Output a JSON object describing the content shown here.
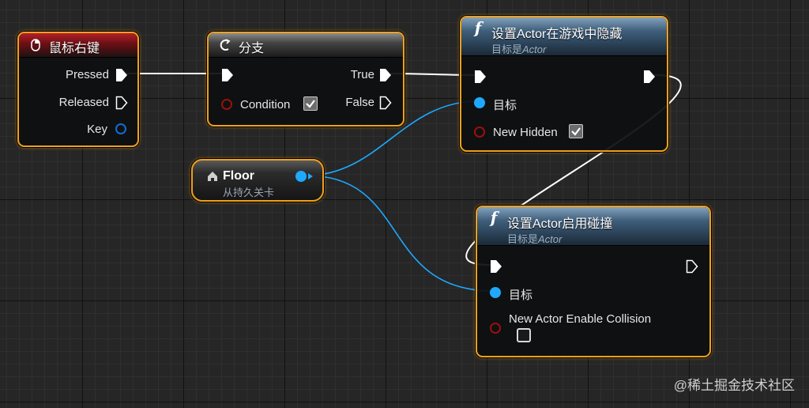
{
  "nodes": {
    "mouse_right": {
      "title": "鼠标右键",
      "pins": {
        "pressed": "Pressed",
        "released": "Released",
        "key": "Key"
      }
    },
    "branch": {
      "title": "分支",
      "pins": {
        "condition": "Condition",
        "true": "True",
        "false": "False"
      },
      "condition_checked": true
    },
    "set_hidden": {
      "title": "设置Actor在游戏中隐藏",
      "subtitle_prefix": "目标是",
      "subtitle_target": "Actor",
      "pins": {
        "target": "目标",
        "new_hidden": "New Hidden"
      },
      "new_hidden_checked": true
    },
    "floor": {
      "title": "Floor",
      "subtitle": "从持久关卡"
    },
    "set_collision": {
      "title": "设置Actor启用碰撞",
      "subtitle_prefix": "目标是",
      "subtitle_target": "Actor",
      "pins": {
        "target": "目标",
        "new_enable_collision": "New Actor Enable Collision"
      },
      "collision_checked": false
    }
  },
  "watermark": "@稀土掘金技术社区",
  "colors": {
    "node_border": "#f0a01c",
    "exec_wire": "#ffffff",
    "object_wire": "#1ea8ff",
    "bool_pin": "#9a1010",
    "event_header": "#b2202a",
    "function_header": "#5a7fa0"
  },
  "icons": {
    "mouse_right": "mouse-icon",
    "branch": "branch-icon",
    "set_hidden": "function-icon",
    "floor": "actor-icon",
    "set_collision": "function-icon"
  }
}
